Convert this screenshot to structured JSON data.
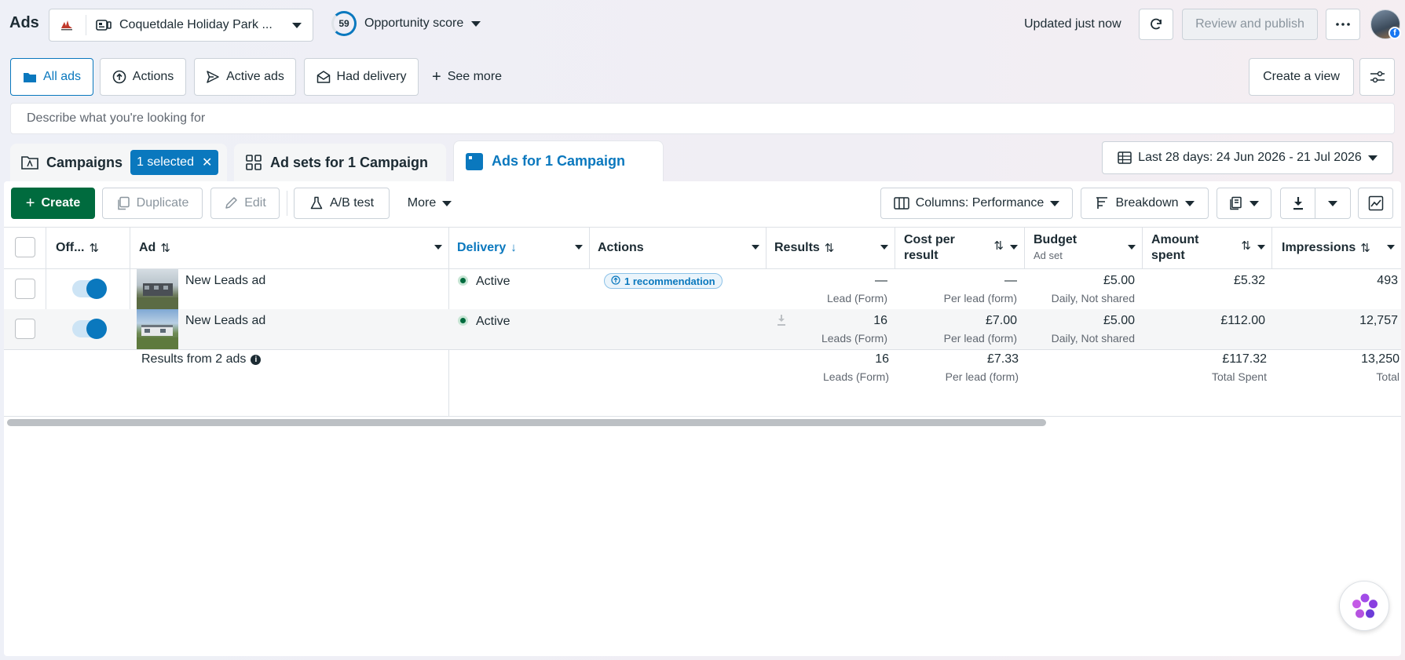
{
  "header": {
    "app_title": "Ads",
    "account_name": "Coquetdale Holiday Park ...",
    "opportunity_score": "59",
    "opportunity_label": "Opportunity score",
    "updated": "Updated just now",
    "review_publish": "Review and publish",
    "avatar_badge": "f"
  },
  "views": {
    "all_ads": "All ads",
    "actions": "Actions",
    "active_ads": "Active ads",
    "had_delivery": "Had delivery",
    "see_more": "See more",
    "create_view": "Create a view"
  },
  "search": {
    "placeholder": "Describe what you're looking for"
  },
  "level_tabs": {
    "campaigns": "Campaigns",
    "selected_chip": "1 selected",
    "ad_sets": "Ad sets for 1 Campaign",
    "ads": "Ads for 1 Campaign"
  },
  "date_range": "Last 28 days: 24 Jun 2026 - 21 Jul 2026",
  "toolbar": {
    "create": "Create",
    "duplicate": "Duplicate",
    "edit": "Edit",
    "ab_test": "A/B test",
    "more": "More",
    "columns": "Columns: Performance",
    "breakdown": "Breakdown"
  },
  "table": {
    "headers": {
      "off_on": "Off...",
      "ad": "Ad",
      "delivery": "Delivery",
      "actions": "Actions",
      "results": "Results",
      "cost_per_result_1": "Cost per",
      "cost_per_result_2": "result",
      "budget": "Budget",
      "budget_sub": "Ad set",
      "amount_spent_1": "Amount",
      "amount_spent_2": "spent",
      "impressions": "Impressions"
    },
    "rows": [
      {
        "enabled": true,
        "ad_name": "New Leads ad",
        "delivery": "Active",
        "action": "1 recommendation",
        "results": "—",
        "results_sub": "Lead (Form)",
        "cost_per_result": "—",
        "cost_sub": "Per lead (form)",
        "budget": "£5.00",
        "budget_sub": "Daily, Not shared",
        "amount_spent": "£5.32",
        "impressions": "493"
      },
      {
        "enabled": true,
        "ad_name": "New Leads ad",
        "delivery": "Active",
        "action": "",
        "results": "16",
        "results_sub": "Leads (Form)",
        "cost_per_result": "£7.00",
        "cost_sub": "Per lead (form)",
        "budget": "£5.00",
        "budget_sub": "Daily, Not shared",
        "amount_spent": "£112.00",
        "impressions": "12,757"
      }
    ],
    "totals": {
      "label": "Results from 2 ads",
      "results": "16",
      "results_sub": "Leads (Form)",
      "cost_per_result": "£7.33",
      "cost_sub": "Per lead (form)",
      "amount_spent": "£117.32",
      "amount_sub": "Total Spent",
      "impressions": "13,250",
      "impressions_sub": "Total"
    }
  },
  "colors": {
    "accent": "#0a78be",
    "create_green": "#006b3e"
  }
}
